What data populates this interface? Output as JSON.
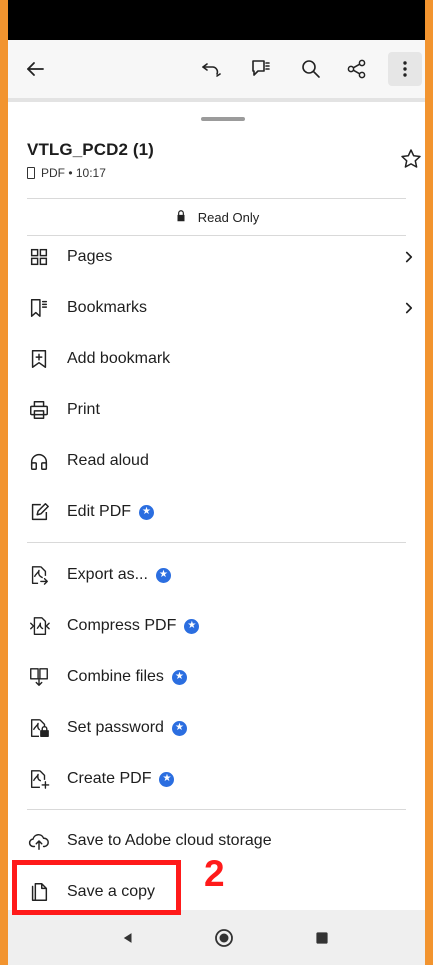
{
  "toolbar": {
    "back_icon": "arrow-left-icon",
    "undo_icon": "undo-icon",
    "comment_icon": "comment-icon",
    "search_icon": "search-icon",
    "share_icon": "share-icon",
    "more_icon": "more-vertical-icon"
  },
  "document": {
    "title": "VTLG_PCD2 (1)",
    "meta": "PDF • 10:17",
    "star_icon": "star-outline-icon"
  },
  "readonly": {
    "label": "Read Only",
    "icon": "lock-icon"
  },
  "menu": {
    "pages": "Pages",
    "bookmarks": "Bookmarks",
    "add_bookmark": "Add bookmark",
    "print": "Print",
    "read_aloud": "Read aloud",
    "edit_pdf": "Edit PDF",
    "export_as": "Export as...",
    "compress_pdf": "Compress PDF",
    "combine_files": "Combine files",
    "set_password": "Set password",
    "create_pdf": "Create PDF",
    "save_cloud": "Save to Adobe cloud storage",
    "save_copy": "Save a copy"
  },
  "annotation": {
    "step_number": "2",
    "color": "#ff1a1a"
  },
  "colors": {
    "accent_border": "#f2942f",
    "premium_badge": "#2b6ee0"
  },
  "navbar": {
    "back_icon": "nav-back-icon",
    "home_icon": "nav-home-icon",
    "recents_icon": "nav-recents-icon"
  }
}
